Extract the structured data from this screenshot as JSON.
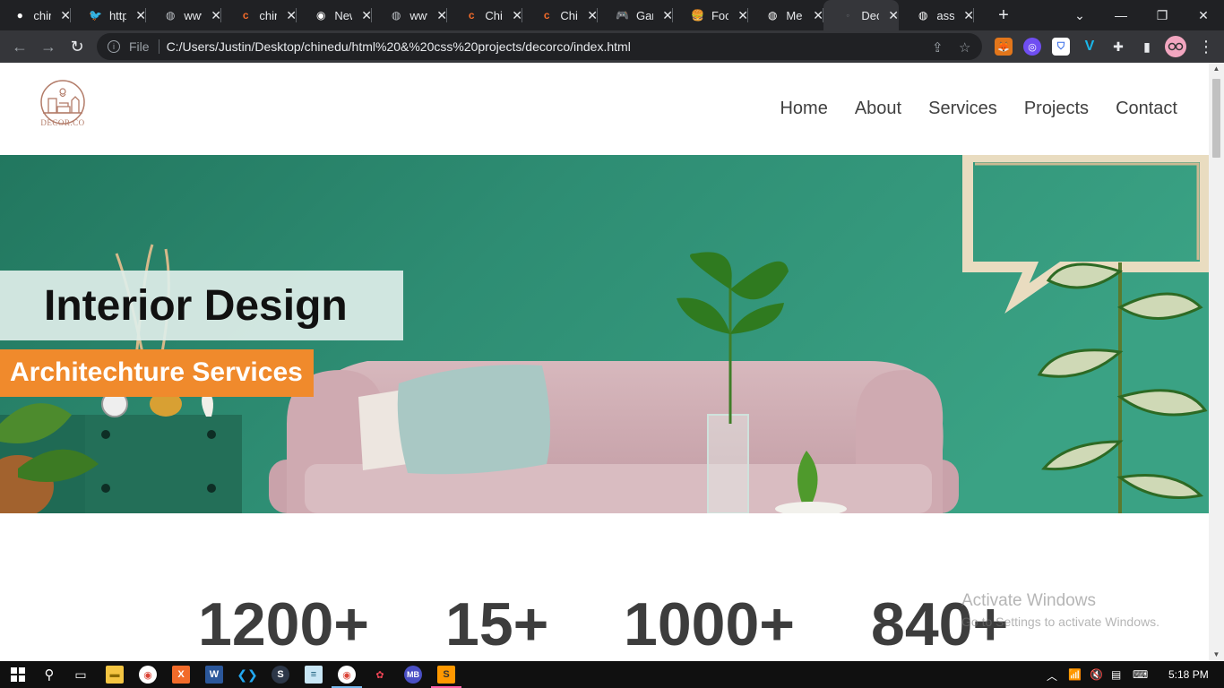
{
  "browser": {
    "tabs": [
      {
        "title": "chinedu",
        "icon": "github-icon",
        "color": "#ffffff"
      },
      {
        "title": "https",
        "icon": "twitter-icon",
        "color": "#1d9bf0"
      },
      {
        "title": "www",
        "icon": "globe-icon",
        "color": "#bdc1c6"
      },
      {
        "title": "chinedu",
        "icon": "codepen-c-icon",
        "color": "#f26b2a"
      },
      {
        "title": "New",
        "icon": "chrome-icon",
        "color": "#ffffff"
      },
      {
        "title": "www",
        "icon": "globe-icon",
        "color": "#bdc1c6"
      },
      {
        "title": "Chi",
        "icon": "codepen-c-icon",
        "color": "#f26b2a"
      },
      {
        "title": "Chi",
        "icon": "codepen-c-icon",
        "color": "#f26b2a"
      },
      {
        "title": "Gam",
        "icon": "gamepad-icon",
        "color": "#f5c542"
      },
      {
        "title": "Foo",
        "icon": "burger-icon",
        "color": "#e5a33a"
      },
      {
        "title": "Me",
        "icon": "globe-icon",
        "color": "#ffffff"
      },
      {
        "title": "Dec",
        "icon": "decor-icon",
        "color": "#5f6368",
        "active": true
      },
      {
        "title": "assi",
        "icon": "globe-icon",
        "color": "#ffffff"
      }
    ],
    "address": {
      "scheme": "File",
      "url": "C:/Users/Justin/Desktop/chinedu/html%20&%20css%20projects/decorco/index.html"
    }
  },
  "site": {
    "logo_text": "DECOR.CO",
    "nav": [
      "Home",
      "About",
      "Services",
      "Projects",
      "Contact"
    ],
    "hero": {
      "title": "Interior Design",
      "subtitle": "Architechture Services"
    },
    "stats": [
      "1200+",
      "15+",
      "1000+",
      "840+"
    ]
  },
  "watermark": {
    "line1": "Activate Windows",
    "line2": "Go to Settings to activate Windows."
  },
  "taskbar": {
    "time": "5:18 PM"
  },
  "colors": {
    "accent_orange": "#f08a2c",
    "hero_teal": "#2f8e74",
    "logo_brown": "#b27b68"
  }
}
